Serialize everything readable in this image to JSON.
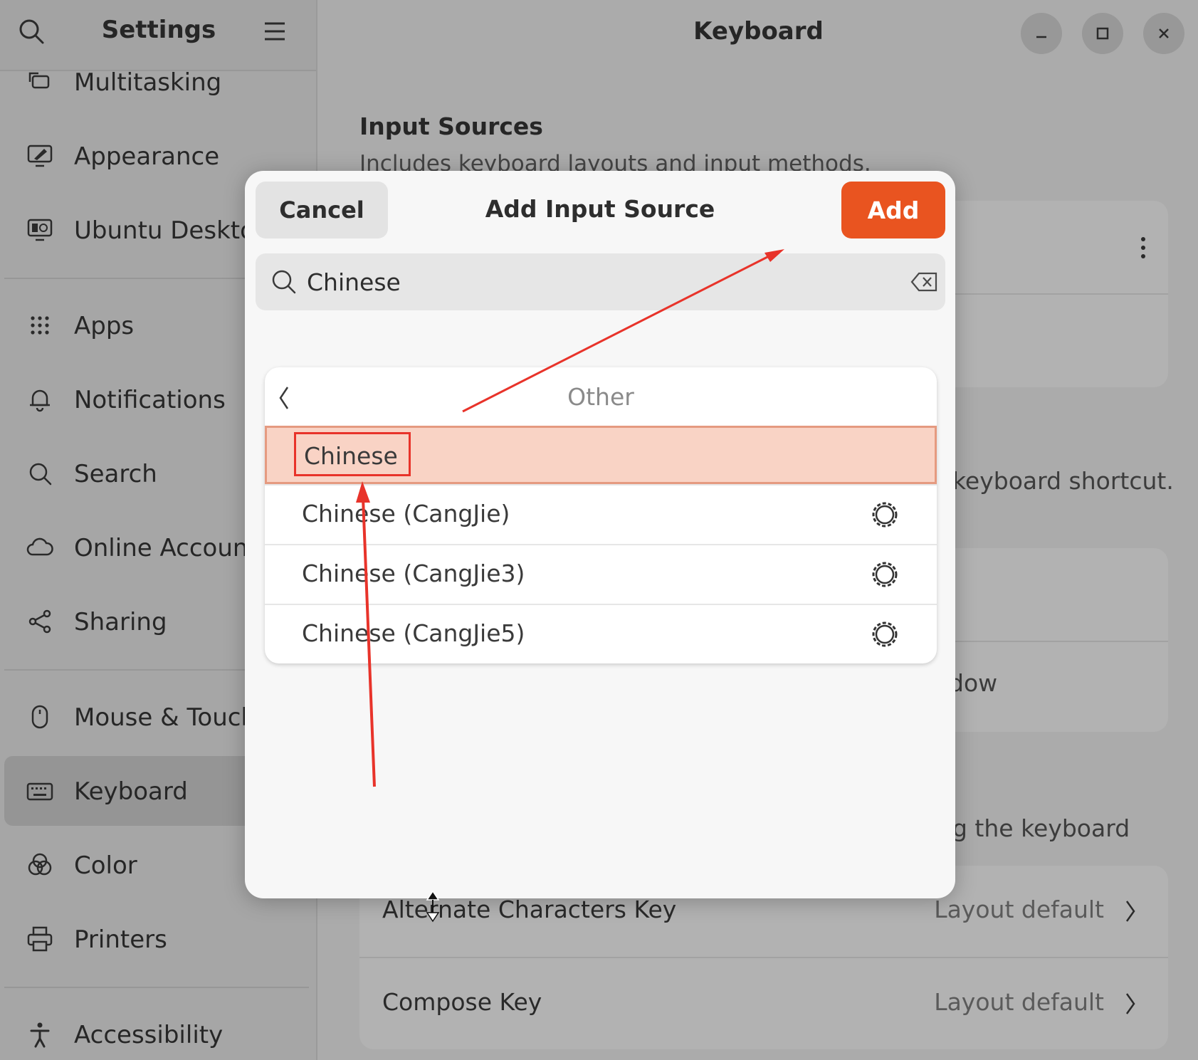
{
  "sidebar": {
    "title": "Settings",
    "items": [
      {
        "label": "Multitasking",
        "icon": "multitasking-icon"
      },
      {
        "label": "Appearance",
        "icon": "appearance-icon"
      },
      {
        "label": "Ubuntu Desktop",
        "icon": "ubuntu-desktop-icon"
      },
      {
        "label": "Apps",
        "icon": "apps-grid-icon"
      },
      {
        "label": "Notifications",
        "icon": "bell-icon"
      },
      {
        "label": "Search",
        "icon": "search-icon"
      },
      {
        "label": "Online Accounts",
        "icon": "cloud-icon"
      },
      {
        "label": "Sharing",
        "icon": "share-icon"
      },
      {
        "label": "Mouse & Touchpad",
        "icon": "mouse-icon"
      },
      {
        "label": "Keyboard",
        "icon": "keyboard-icon",
        "active": true
      },
      {
        "label": "Color",
        "icon": "color-icon"
      },
      {
        "label": "Printers",
        "icon": "printer-icon"
      },
      {
        "label": "Accessibility",
        "icon": "accessibility-icon"
      }
    ]
  },
  "main": {
    "title": "Keyboard",
    "section_title": "Input Sources",
    "section_subtitle": "Includes keyboard layouts and input methods.",
    "bg_text_1": "keyboard shortcut.",
    "bg_text_2": "dow",
    "bg_text_3": "g the keyboard",
    "rows": [
      {
        "label": "Alternate Characters Key",
        "value": "Layout default"
      },
      {
        "label": "Compose Key",
        "value": "Layout default"
      }
    ]
  },
  "dialog": {
    "title": "Add Input Source",
    "cancel_label": "Cancel",
    "add_label": "Add",
    "search_value": "Chinese",
    "list_header": "Other",
    "items": [
      {
        "label": "Chinese",
        "selected": true,
        "has_settings": false
      },
      {
        "label": "Chinese (CangJie)",
        "selected": false,
        "has_settings": true
      },
      {
        "label": "Chinese (CangJie3)",
        "selected": false,
        "has_settings": true
      },
      {
        "label": "Chinese (CangJie5)",
        "selected": false,
        "has_settings": true
      }
    ]
  },
  "colors": {
    "accent": "#e95420",
    "selection": "#f9d3c5",
    "annotation": "#e8332a"
  }
}
